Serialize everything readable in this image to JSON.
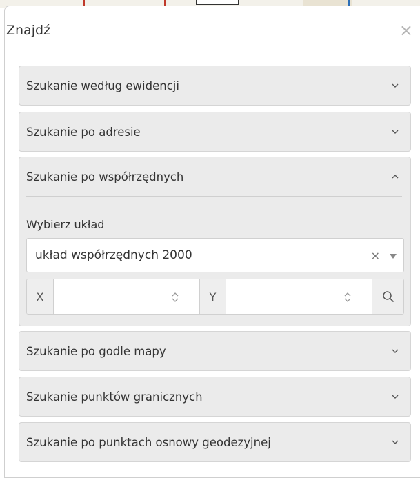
{
  "panel": {
    "title": "Znajdź",
    "close_glyph": "×"
  },
  "sections": [
    {
      "label": "Szukanie według ewidencji",
      "expanded": false
    },
    {
      "label": "Szukanie po adresie",
      "expanded": false
    },
    {
      "label": "Szukanie po współrzędnych",
      "expanded": true
    },
    {
      "label": "Szukanie po godle mapy",
      "expanded": false
    },
    {
      "label": "Szukanie punktów granicznych",
      "expanded": false
    },
    {
      "label": "Szukanie po punktach osnowy geodezyjnej",
      "expanded": false
    }
  ],
  "coords": {
    "system_label": "Wybierz układ",
    "system_value": "układ współrzędnych 2000",
    "clear_glyph": "×",
    "x_label": "X",
    "x_value": "",
    "y_label": "Y",
    "y_value": ""
  },
  "icons": {
    "close": "close-icon",
    "collapsed": "chevron-down-icon",
    "expanded": "chevron-up-icon",
    "dropdown": "caret-down-icon",
    "spinner": "spinner-icon",
    "search": "search-icon"
  },
  "colors": {
    "section_bg": "#ebebeb",
    "text": "#333333",
    "muted_icon": "#b5b5b5"
  }
}
